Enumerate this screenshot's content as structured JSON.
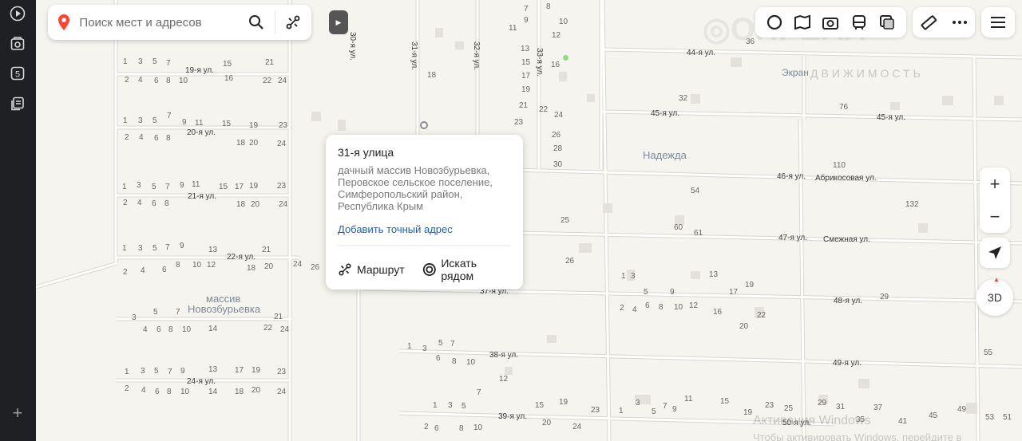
{
  "search": {
    "placeholder": "Поиск мест и адресов"
  },
  "popup": {
    "title": "31-я улица",
    "address_lines": [
      "дачный массив Новозбурьевка,",
      "Перовское сельское поселение,",
      "Симферопольский район,",
      "Республика Крым"
    ],
    "add_address_link": "Добавить точный адрес",
    "route_label": "Маршрут",
    "search_nearby_label": "Искать рядом"
  },
  "controls": {
    "zoom_in": "+",
    "zoom_out": "−",
    "three_d": "3D"
  },
  "sidebar": {
    "add": "+"
  },
  "map": {
    "streets": {
      "s19": "19-я ул.",
      "s20": "20-я ул.",
      "s21": "21-я ул.",
      "s22": "22-я ул.",
      "s24": "24-я ул.",
      "s30": "30-я ул.",
      "s31": "31-я ул.",
      "s32": "32-я ул.",
      "s33": "33-я ул.",
      "s37": "37-я ул.",
      "s38": "38-я ул.",
      "s39": "39-я ул.",
      "s44": "44-я ул.",
      "s45a": "45-я ул.",
      "s45b": "45-я ул.",
      "s46": "46-я ул.",
      "s47": "47-я ул.",
      "s48": "48-я ул.",
      "s49": "49-я ул.",
      "s50": "50-я ул.",
      "abrik": "Абрикосовая ул.",
      "smezh": "Смежная ул."
    },
    "places": {
      "nadezhda": "Надежда",
      "massiv_1": "массив",
      "massiv_2": "Новозбурьевка",
      "ekran": "Экран"
    },
    "watermarks": {
      "w1": "Активация Windows",
      "w2": "Чтобы активировать Windows, перейдите в",
      "w3": "ДВИЖИМОСТЬ"
    }
  }
}
